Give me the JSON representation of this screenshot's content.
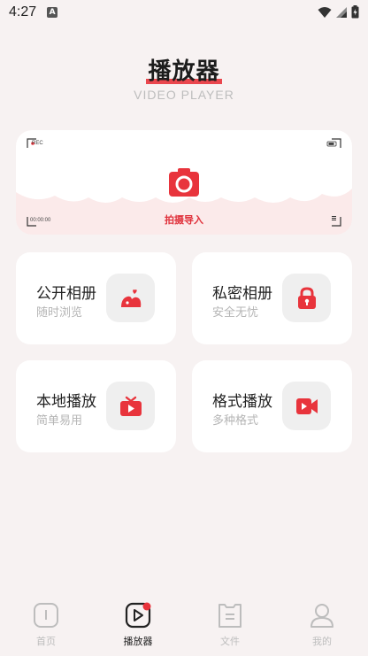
{
  "status_bar": {
    "time": "4:27",
    "notification_letter": "A"
  },
  "header": {
    "title": "播放器",
    "subtitle": "VIDEO PLAYER"
  },
  "camera_card": {
    "rec_label": "REC",
    "timecode": "00:00:00",
    "action_label": "拍摄导入"
  },
  "features": [
    {
      "title": "公开相册",
      "subtitle": "随时浏览",
      "icon": "photo-album-icon"
    },
    {
      "title": "私密相册",
      "subtitle": "安全无忧",
      "icon": "lock-icon"
    },
    {
      "title": "本地播放",
      "subtitle": "简单易用",
      "icon": "tv-icon"
    },
    {
      "title": "格式播放",
      "subtitle": "多种格式",
      "icon": "video-camera-icon"
    }
  ],
  "bottom_nav": [
    {
      "label": "首页",
      "icon": "home-icon",
      "active": false
    },
    {
      "label": "播放器",
      "icon": "player-icon",
      "active": true
    },
    {
      "label": "文件",
      "icon": "file-icon",
      "active": false
    },
    {
      "label": "我的",
      "icon": "profile-icon",
      "active": false
    }
  ],
  "colors": {
    "accent": "#e8343c",
    "background": "#f7f2f2",
    "card": "#ffffff",
    "icon_bg": "#efefef"
  }
}
